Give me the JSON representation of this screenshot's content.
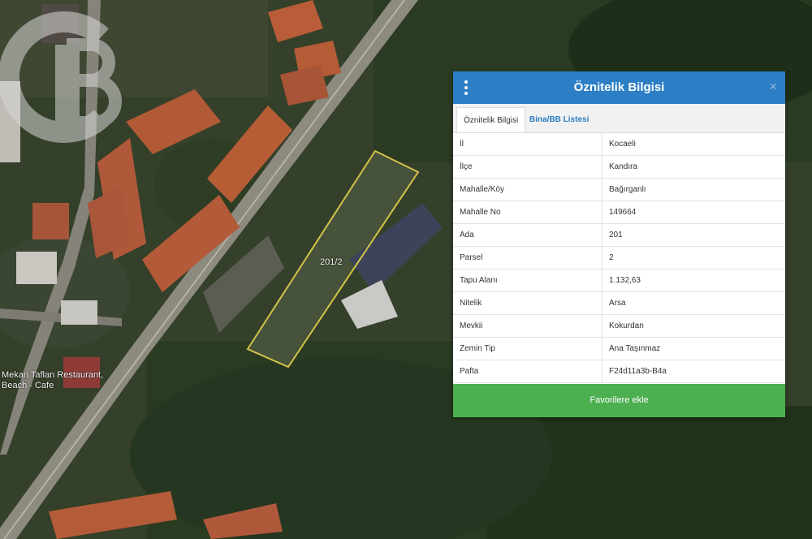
{
  "map": {
    "restaurant_label_line1": "Mekan Taflan Restaurant,",
    "restaurant_label_line2": "Beach - Cafe",
    "parcel_label": "201/2"
  },
  "panel": {
    "title": "Öznitelik Bilgisi",
    "close_icon": "close-icon",
    "menu_icon": "kebab-menu-icon",
    "tabs": [
      {
        "label": "Öznitelik Bilgisi",
        "active": true
      },
      {
        "label": "Bina/BB Listesi",
        "active": false
      }
    ],
    "rows": [
      {
        "key": "İl",
        "value": "Kocaeli"
      },
      {
        "key": "İlçe",
        "value": "Kandıra"
      },
      {
        "key": "Mahalle/Köy",
        "value": "Bağırganlı"
      },
      {
        "key": "Mahalle No",
        "value": "149664"
      },
      {
        "key": "Ada",
        "value": "201"
      },
      {
        "key": "Parsel",
        "value": "2"
      },
      {
        "key": "Tapu Alanı",
        "value": "1.132,63"
      },
      {
        "key": "Nitelik",
        "value": "Arsa"
      },
      {
        "key": "Mevkii",
        "value": "Kokurdan"
      },
      {
        "key": "Zemin Tip",
        "value": "Ana Taşınmaz"
      },
      {
        "key": "Pafta",
        "value": "F24d11a3b-B4a"
      }
    ],
    "favorite_button": "Favorilere ekle"
  },
  "colors": {
    "header": "#2c7fc4",
    "button": "#4cb050",
    "parcel_outline": "#d4c34a"
  }
}
